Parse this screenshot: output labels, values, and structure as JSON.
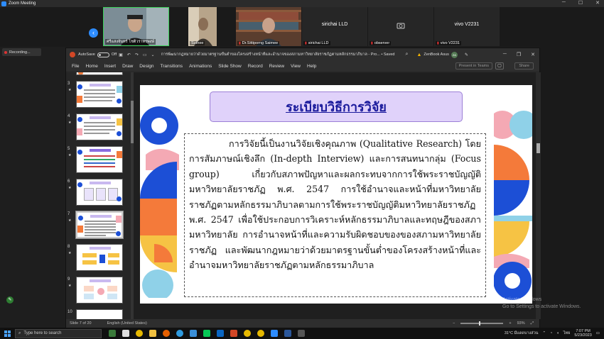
{
  "zoom": {
    "window_title": "Zoom Meeting",
    "recording_label": "Recording...",
    "participants": [
      {
        "name": "ศรีแสงจันทร์ โชติวราทรพงษ์",
        "muted": false
      },
      {
        "name": "Suthee",
        "muted": false
      },
      {
        "name": "Dr.Sittiporng Saimee",
        "muted": true
      },
      {
        "name": "sirichai LLD",
        "muted": true
      },
      {
        "name": "observer",
        "muted": true
      },
      {
        "name": "vivo V2231",
        "muted": true
      }
    ],
    "tile_center_names": [
      "sirichai LLD",
      "vivo V2231"
    ]
  },
  "ppt": {
    "autosave_label": "AutoSave",
    "autosave_state": "Off",
    "doc_title": "การพัฒนากฎหมายว่าด้วยมาตรฐานขั้นต่ำของโครงสร้างหน้าที่และอำนาจของสภามหาวิทยาลัยราชภัฏตามหลักธรรมาภิบาล - Pro... • Saved to this PC",
    "user_name": "ZenBook Asus",
    "user_initials": "ZA",
    "menu": [
      "File",
      "Home",
      "Insert",
      "Draw",
      "Design",
      "Transitions",
      "Animations",
      "Slide Show",
      "Record",
      "Review",
      "View",
      "Help"
    ],
    "present_in_teams": "Present in Teams",
    "share_label": "Share",
    "thumb_numbers": [
      "3",
      "4",
      "5",
      "6",
      "7",
      "8",
      "9",
      "10"
    ],
    "selected_thumb": "7",
    "slide": {
      "title": "ระเบียบวิธีการวิจัย",
      "body": "การวิจัยนี้เป็นงานวิจัยเชิงคุณภาพ (Qualitative Research) โดยการสัมภาษณ์เชิงลึก (In-depth Interview) และการสนทนากลุ่ม (Focus group) เกี่ยวกับสภาพปัญหาและผลกระทบจากการใช้พระราชบัญญัติมหาวิทยาลัยราชภัฏ พ.ศ. 2547 การใช้อำนาจและหน้าที่มหาวิทยาลัยราชภัฏตามหลักธรรมาภิบาลตามการใช้พระราชบัญญัติมหาวิทยาลัยราชภัฏ พ.ศ. 2547 เพื่อใช้ประกอบการวิเคราะห์หลักธรรมาภิบาลและทฤษฎีของสภามหาวิทยาลัย การอำนาจหน้าที่และความรับผิดชอบของของสภามหาวิทยาลัยราชภัฏ และพัฒนากฎหมายว่าด้วยมาตรฐานขั้นต่ำของโครงสร้างหน้าที่และอำนาจมหาวิทยาลัยราชภัฏตามหลักธรรมาภิบาล"
    },
    "status": {
      "slide_info": "Slide 7 of 20",
      "language": "English (United States)",
      "zoom_level": "93%"
    }
  },
  "watermark": {
    "line1": "Activate Windows",
    "line2": "Go to Settings to activate Windows."
  },
  "taskbar": {
    "search_placeholder": "Type here to search",
    "weather": "31°C มีแดดบางส่วน",
    "language": "ไทย",
    "time": "7:07 PM",
    "date": "5/23/2023"
  },
  "colors": {
    "accent_blue": "#1c4fd6",
    "accent_orange": "#f47a3a",
    "accent_pink": "#f4a9b4",
    "accent_light_blue": "#8fd1e8",
    "accent_yellow": "#f6c344",
    "title_purple": "#e0d2fa"
  }
}
